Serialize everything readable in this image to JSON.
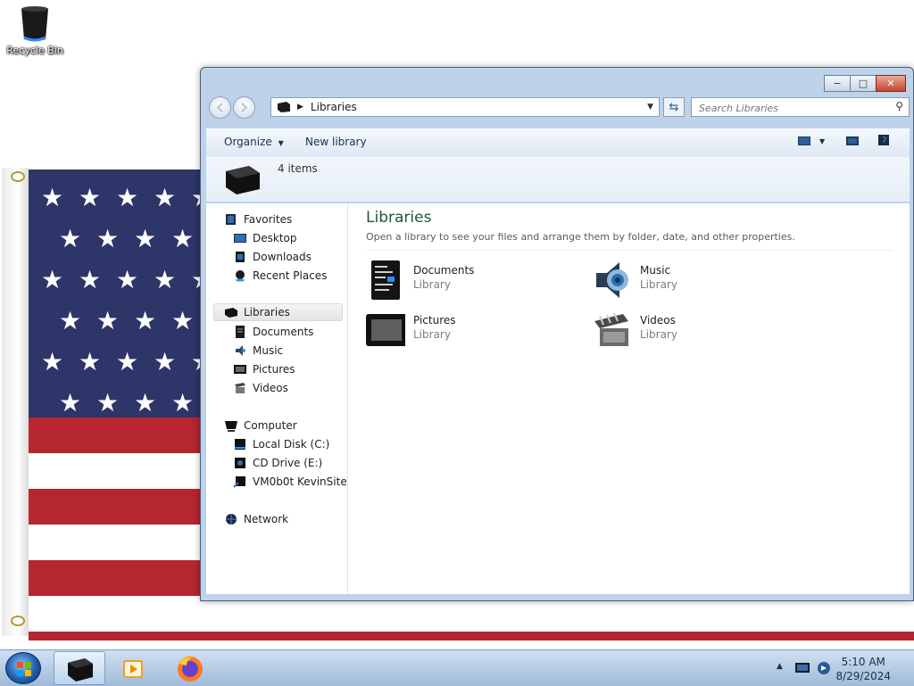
{
  "desktop": {
    "recycle_bin_label": "Recycle Bin"
  },
  "window": {
    "caption_buttons": {
      "minimize": "−",
      "maximize": "□",
      "close": "✕"
    },
    "address": {
      "path_label": "Libraries"
    },
    "search": {
      "placeholder": "Search Libraries"
    },
    "toolbar": {
      "organize_label": "Organize",
      "new_library_label": "New library"
    },
    "details": {
      "item_count": "4 items"
    },
    "navigation": {
      "favorites_label": "Favorites",
      "favorites": [
        {
          "label": "Desktop",
          "icon": "desktop-icon"
        },
        {
          "label": "Downloads",
          "icon": "downloads-icon"
        },
        {
          "label": "Recent Places",
          "icon": "recent-places-icon"
        }
      ],
      "libraries_label": "Libraries",
      "libraries": [
        {
          "label": "Documents",
          "icon": "documents-icon"
        },
        {
          "label": "Music",
          "icon": "music-icon"
        },
        {
          "label": "Pictures",
          "icon": "pictures-icon"
        },
        {
          "label": "Videos",
          "icon": "videos-icon"
        }
      ],
      "computer_label": "Computer",
      "computer": [
        {
          "label": "Local Disk (C:)",
          "icon": "local-disk-icon"
        },
        {
          "label": "CD Drive (E:)",
          "icon": "cd-drive-icon"
        },
        {
          "label": "VM0b0t KevinSite",
          "icon": "network-share-icon"
        }
      ],
      "network_label": "Network"
    },
    "content": {
      "title": "Libraries",
      "subtitle": "Open a library to see your files and arrange them by folder, date, and other properties.",
      "libraries": [
        {
          "name": "Documents",
          "type": "Library",
          "icon": "documents-library-icon"
        },
        {
          "name": "Music",
          "type": "Library",
          "icon": "music-library-icon"
        },
        {
          "name": "Pictures",
          "type": "Library",
          "icon": "pictures-library-icon"
        },
        {
          "name": "Videos",
          "type": "Library",
          "icon": "videos-library-icon"
        }
      ]
    }
  },
  "taskbar": {
    "clock": {
      "time": "5:10 AM",
      "date": "8/29/2024"
    },
    "pinned": [
      "explorer-icon",
      "media-player-icon",
      "firefox-icon"
    ]
  },
  "colors": {
    "window_frame": "#bed3ea",
    "content_title": "#1e5a2a",
    "close_button": "#c5452c",
    "flag_blue": "#2e3568",
    "flag_red": "#b5262f"
  }
}
